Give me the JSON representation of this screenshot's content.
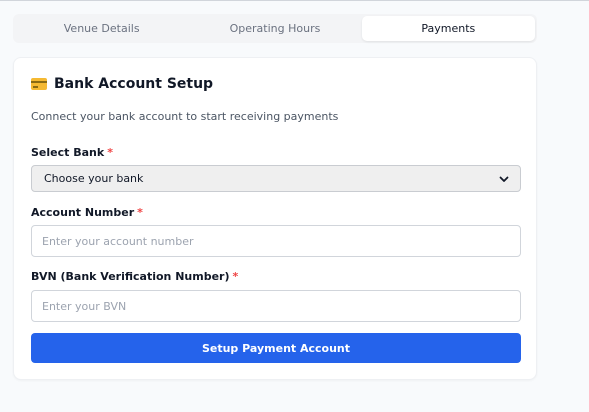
{
  "tabs": [
    {
      "label": "Venue Details",
      "active": false
    },
    {
      "label": "Operating Hours",
      "active": false
    },
    {
      "label": "Payments",
      "active": true
    }
  ],
  "card": {
    "icon": "credit-card-icon",
    "title": "Bank Account Setup",
    "subtitle": "Connect your bank account to start receiving payments"
  },
  "form": {
    "bank": {
      "label": "Select Bank",
      "required_marker": "*",
      "selected": "Choose your bank"
    },
    "account_number": {
      "label": "Account Number",
      "required_marker": "*",
      "value": "",
      "placeholder": "Enter your account number"
    },
    "bvn": {
      "label": "BVN (Bank Verification Number)",
      "required_marker": "*",
      "value": "",
      "placeholder": "Enter your BVN"
    },
    "submit_label": "Setup Payment Account"
  },
  "colors": {
    "accent": "#2563eb",
    "required": "#ef4444",
    "card_icon": "#f5b932"
  }
}
